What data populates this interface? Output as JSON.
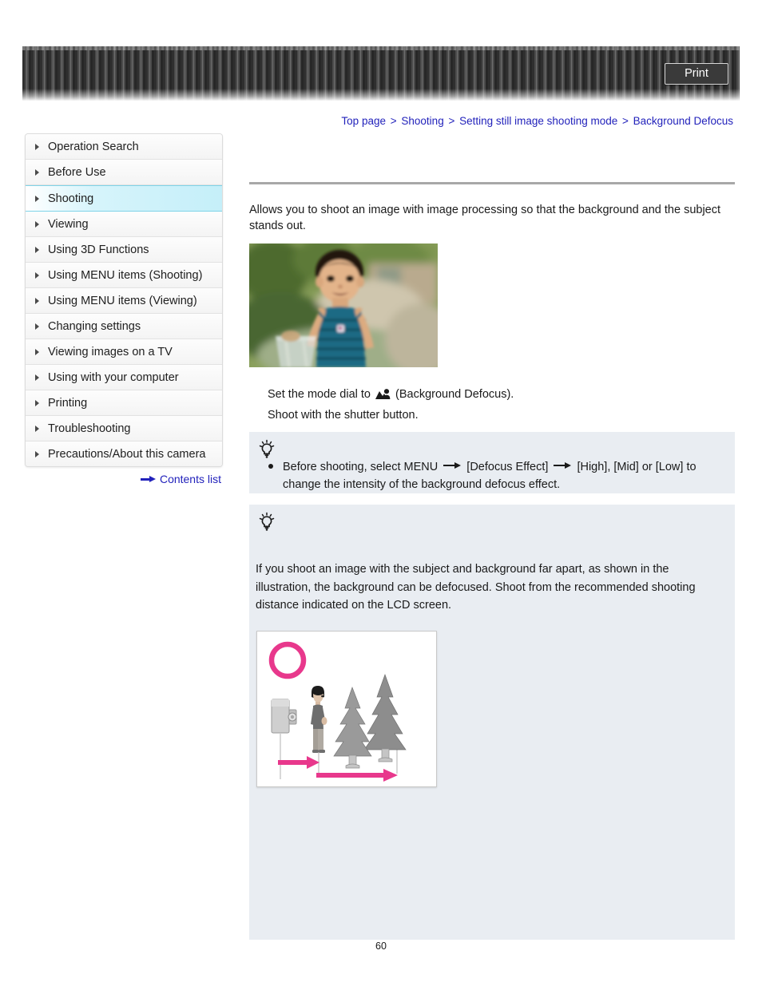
{
  "header": {
    "print_label": "Print",
    "print_icon": "print-icon"
  },
  "breadcrumb": {
    "separator": ">",
    "items": [
      {
        "label": "Top page"
      },
      {
        "label": "Shooting"
      },
      {
        "label": "Setting still image shooting mode"
      },
      {
        "label": "Background Defocus"
      }
    ]
  },
  "sidebar": {
    "items": [
      {
        "label": "Operation Search",
        "active": false
      },
      {
        "label": "Before Use",
        "active": false
      },
      {
        "label": "Shooting",
        "active": true
      },
      {
        "label": "Viewing",
        "active": false
      },
      {
        "label": "Using 3D Functions",
        "active": false
      },
      {
        "label": "Using MENU items (Shooting)",
        "active": false
      },
      {
        "label": "Using MENU items (Viewing)",
        "active": false
      },
      {
        "label": "Changing settings",
        "active": false
      },
      {
        "label": "Viewing images on a TV",
        "active": false
      },
      {
        "label": "Using with your computer",
        "active": false
      },
      {
        "label": "Printing",
        "active": false
      },
      {
        "label": "Troubleshooting",
        "active": false
      },
      {
        "label": "Precautions/About this camera",
        "active": false
      }
    ],
    "contents_link": "Contents list",
    "contents_icon": "right-arrow-icon"
  },
  "main": {
    "intro": "Allows you to shoot an image with image processing so that the background and the subject stands out.",
    "sample_photo_alt": "sample-photo-child-with-defocused-background",
    "steps": [
      {
        "before_icon": "Set the mode dial to ",
        "icon": "background-defocus-mode-icon",
        "after_icon": " (Background Defocus)."
      },
      {
        "before_icon": "Shoot with the shutter button.",
        "icon": "",
        "after_icon": ""
      }
    ]
  },
  "tips": [
    {
      "icon": "lightbulb-icon",
      "bullet_parts": [
        "Before shooting, select MENU ",
        " [Defocus Effect] ",
        " [High], [Mid] or [Low] to change the intensity of the background defocus effect."
      ]
    },
    {
      "icon": "lightbulb-icon",
      "paragraph": "If you shoot an image with the subject and background far apart, as shown in the illustration, the background can be defocused. Shoot from the recommended shooting distance indicated on the LCD screen.",
      "illustration_alt": "illustration-camera-subject-trees-distance"
    }
  ],
  "footer": {
    "page_number": "60"
  },
  "colors": {
    "link": "#2222bb",
    "tip_background": "#e9edf2",
    "active_nav": "#c5eff9",
    "accent_pink": "#e8388c",
    "rule": "#a8a8a8"
  }
}
